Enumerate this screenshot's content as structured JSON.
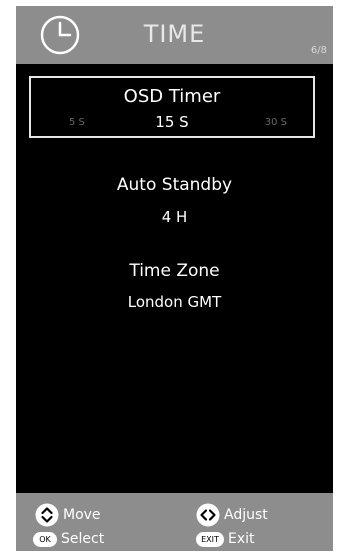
{
  "header": {
    "title": "TIME",
    "page_indicator": "6/8",
    "icon": "clock-icon"
  },
  "osd_timer": {
    "label": "OSD Timer",
    "min": "5 S",
    "value": "15 S",
    "max": "30 S"
  },
  "auto_standby": {
    "label": "Auto Standby",
    "value": "4 H"
  },
  "time_zone": {
    "label": "Time Zone",
    "value": "London GMT"
  },
  "footer": {
    "move_label": "Move",
    "adjust_label": "Adjust",
    "ok_key": "OK",
    "select_label": "Select",
    "exit_key": "EXIT",
    "exit_label": "Exit"
  },
  "colors": {
    "panel_gray": "#8d8d8d",
    "background": "#000000",
    "text": "#ffffff",
    "dim_text": "#666666"
  }
}
